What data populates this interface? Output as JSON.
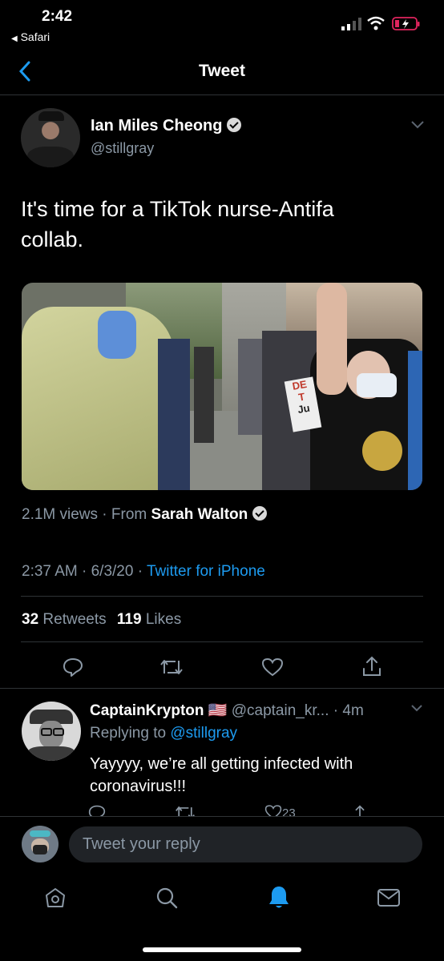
{
  "status_bar": {
    "time": "2:42",
    "back_app": "Safari"
  },
  "header": {
    "title": "Tweet"
  },
  "tweet": {
    "author_name": "Ian Miles Cheong",
    "author_handle": "@stillgray",
    "text": "It's time for a TikTok nurse-Antifa collab.",
    "sign_text_1": "DE",
    "sign_text_2": "T",
    "sign_text_3": "Ju",
    "views": "2.1M views",
    "from_label": "From",
    "from_name": "Sarah Walton",
    "time": "2:37 AM",
    "date": "6/3/20",
    "client": "Twitter for iPhone",
    "retweets_count": "32",
    "retweets_label": "Retweets",
    "likes_count": "119",
    "likes_label": "Likes"
  },
  "reply": {
    "author_name": "CaptainKrypton",
    "flag": "🇺🇸",
    "author_handle": "@captain_kr...",
    "time": "4m",
    "replying_label": "Replying to",
    "replying_to": "@stillgray",
    "text": "Yayyyy, we’re all getting infected with coronavirus!!!",
    "like_count": "23"
  },
  "composer": {
    "placeholder": "Tweet your reply"
  },
  "colors": {
    "accent": "#1d9bf0",
    "background": "#000000",
    "secondary_text": "#8b98a5"
  }
}
